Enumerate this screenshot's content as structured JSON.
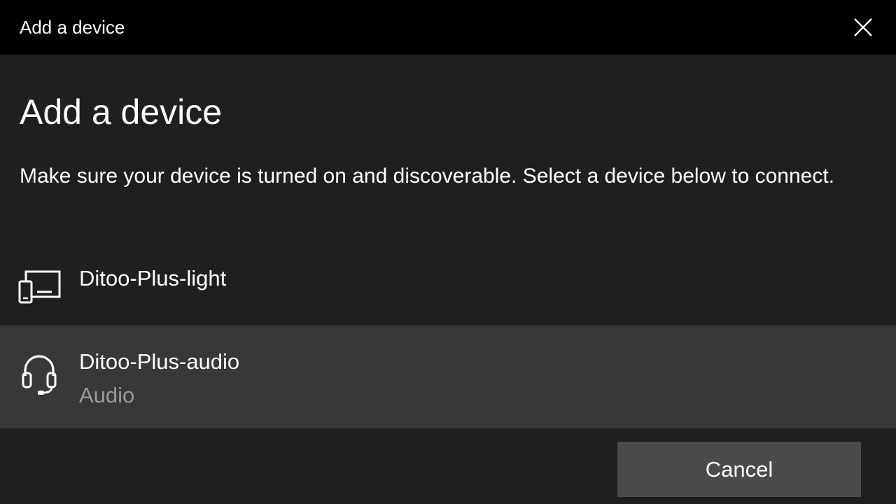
{
  "window": {
    "title": "Add a device"
  },
  "dialog": {
    "heading": "Add a device",
    "instructions": "Make sure your device is turned on and discoverable. Select a device below to connect.",
    "devices": [
      {
        "name": "Ditoo-Plus-light",
        "type": "",
        "icon": "display-device-icon"
      },
      {
        "name": "Ditoo-Plus-audio",
        "type": "Audio",
        "icon": "headset-icon"
      }
    ],
    "cancel_label": "Cancel"
  },
  "colors": {
    "titlebar_bg": "#000000",
    "dialog_bg": "#1f1f1f",
    "selected_row_bg": "#383838",
    "button_bg": "#4b4b4b",
    "secondary_text": "#9a9a9a"
  }
}
